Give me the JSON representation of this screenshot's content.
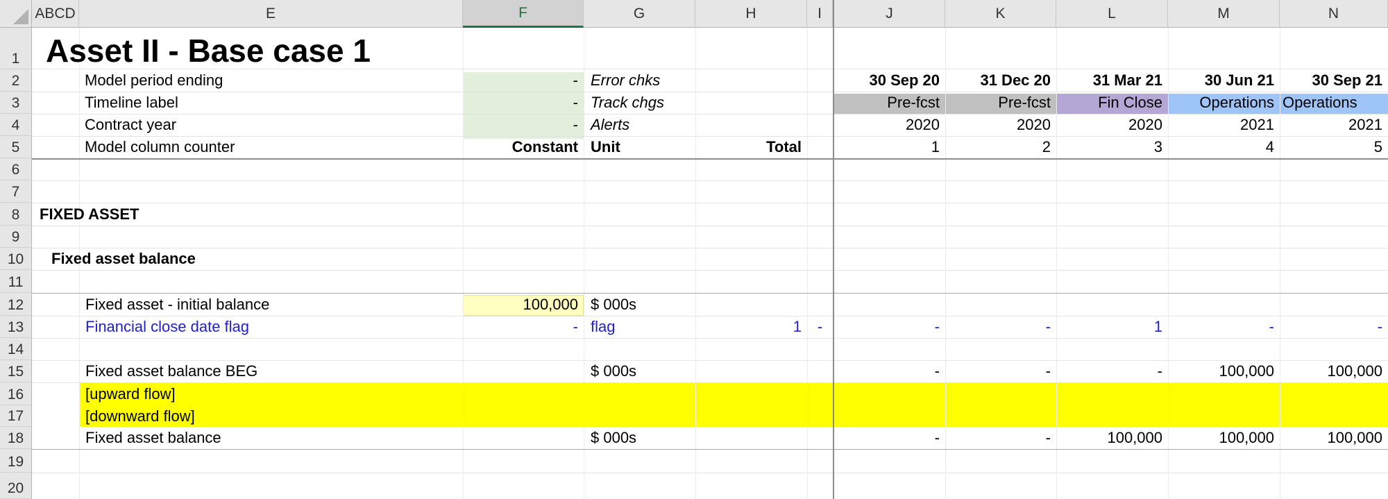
{
  "columns": {
    "abcd": "ABCD",
    "e": "E",
    "f": "F",
    "g": "G",
    "h": "H",
    "i": "I",
    "j": "J",
    "k": "K",
    "l": "L",
    "m": "M",
    "n": "N"
  },
  "rows": [
    "1",
    "2",
    "3",
    "4",
    "5",
    "6",
    "7",
    "8",
    "9",
    "10",
    "11",
    "12",
    "13",
    "14",
    "15",
    "16",
    "17",
    "18",
    "19",
    "20"
  ],
  "title": "Asset II - Base case 1",
  "header": {
    "row2": {
      "label": "Model period ending",
      "f": "-",
      "g": "Error chks"
    },
    "row3": {
      "label": "Timeline label",
      "f": "-",
      "g": "Track chgs"
    },
    "row4": {
      "label": "Contract year",
      "f": "-",
      "g": "Alerts"
    },
    "row5": {
      "label": "Model column counter",
      "f": "Constant",
      "g": "Unit",
      "h": "Total"
    }
  },
  "timeline": [
    {
      "date": "30 Sep 20",
      "label": "Pre-fcst",
      "year": "2020",
      "counter": "1"
    },
    {
      "date": "31 Dec 20",
      "label": "Pre-fcst",
      "year": "2020",
      "counter": "2"
    },
    {
      "date": "31 Mar 21",
      "label": "Fin Close",
      "year": "2020",
      "counter": "3"
    },
    {
      "date": "30 Jun 21",
      "label": "Operations",
      "year": "2021",
      "counter": "4"
    },
    {
      "date": "30 Sep 21",
      "label": "Operations",
      "year": "2021",
      "counter": "5"
    }
  ],
  "sections": {
    "fixed_asset": "FIXED ASSET",
    "fixed_asset_balance": "Fixed asset balance"
  },
  "row12": {
    "label": "Fixed asset - initial balance",
    "f": "100,000",
    "g": "$ 000s"
  },
  "row13": {
    "label": "Financial close date flag",
    "f": "-",
    "g": "flag",
    "h": "1",
    "i": "-",
    "values": [
      "-",
      "-",
      "1",
      "-",
      "-"
    ]
  },
  "row15": {
    "label": "Fixed asset balance BEG",
    "g": "$ 000s",
    "values": [
      "-",
      "-",
      "-",
      "100,000",
      "100,000"
    ]
  },
  "row16": {
    "label": "[upward flow]"
  },
  "row17": {
    "label": "[downward flow]"
  },
  "row18": {
    "label": "Fixed asset balance",
    "g": "$ 000s",
    "values": [
      "-",
      "-",
      "100,000",
      "100,000",
      "100,000"
    ]
  },
  "colors": {
    "prefcst": "#c0c0c0",
    "finclose": "#b4a7d6",
    "operations": "#9fc5f8",
    "input_green": "#e2efda",
    "input_yellow": "#ffffc0",
    "flow_yellow": "#ffff00",
    "link_blue": "#1f1fcc"
  }
}
